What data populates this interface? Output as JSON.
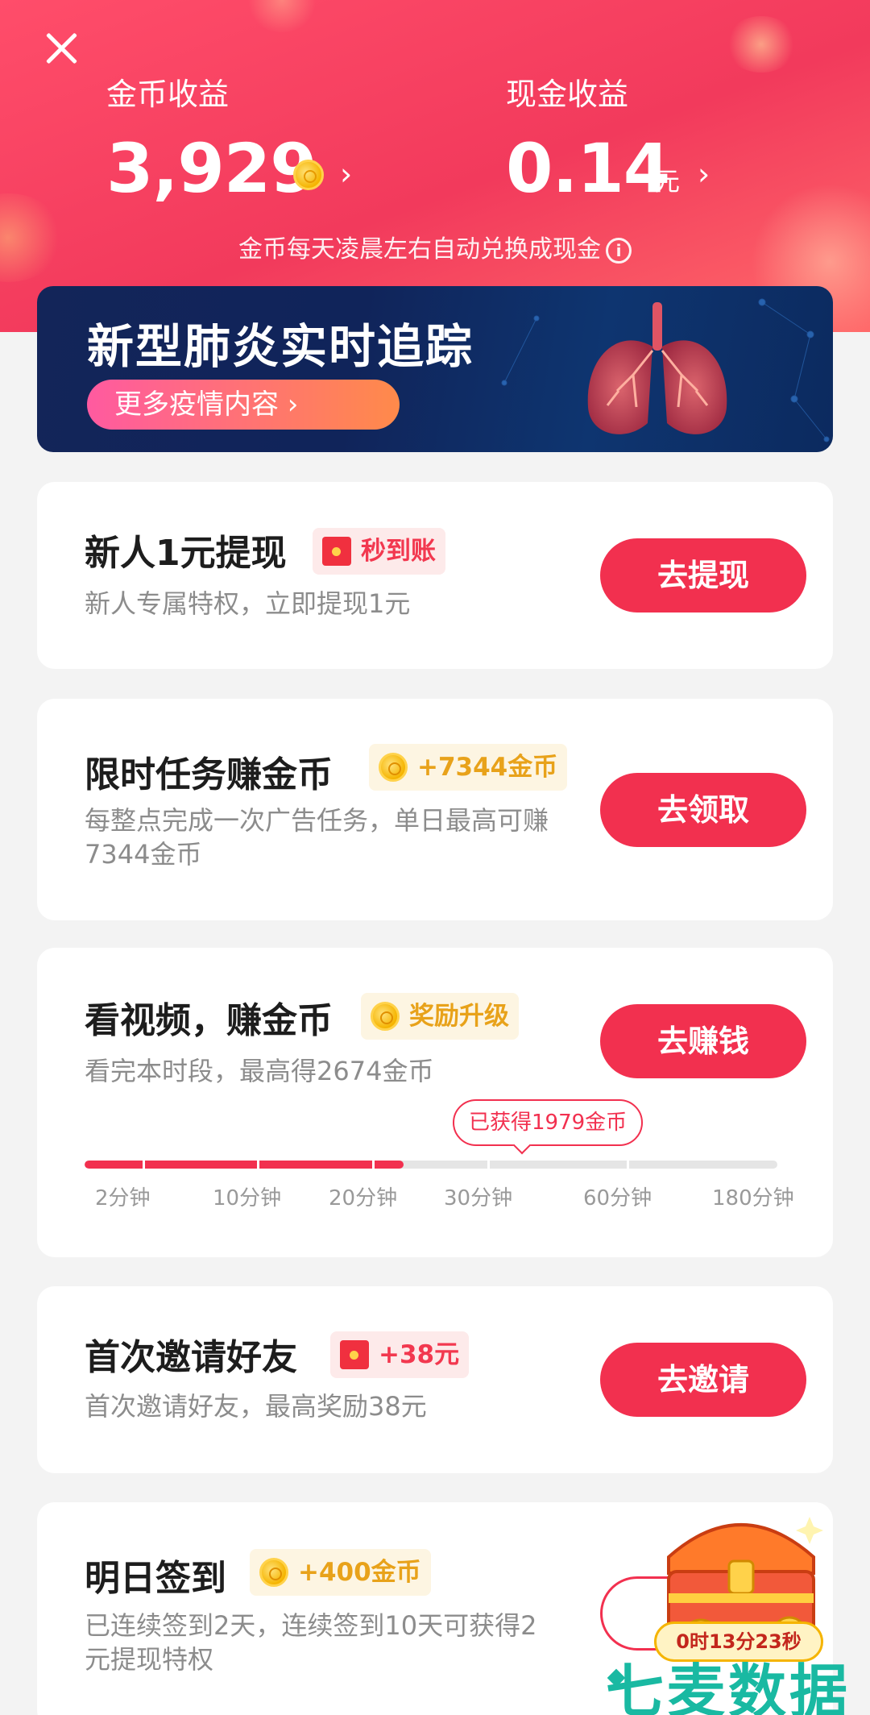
{
  "header": {
    "coin_label": "金币收益",
    "coin_value": "3,929",
    "cash_label": "现金收益",
    "cash_value": "0.14",
    "cash_unit": "元",
    "note": "金币每天凌晨左右自动兑换成现金",
    "info_icon_glyph": "i",
    "chevron": "›"
  },
  "banner": {
    "title": "新型肺炎实时追踪",
    "button": "更多疫情内容 ›"
  },
  "tasks": [
    {
      "title": "新人1元提现",
      "badge": "秒到账",
      "badge_icon": "red-envelope-icon",
      "desc": "新人专属特权，立即提现1元",
      "button": "去提现"
    },
    {
      "title": "限时任务赚金币",
      "badge": "+7344金币",
      "badge_icon": "coin-icon",
      "desc": "每整点完成一次广告任务，单日最高可赚7344金币",
      "button": "去领取"
    },
    {
      "title": "看视频，赚金币",
      "badge": "奖励升级",
      "badge_icon": "coin-icon",
      "desc": "看完本时段，最高得2674金币",
      "button": "去赚钱",
      "progress": {
        "earned_tip": "已获得1979金币",
        "ticks": [
          "2分钟",
          "10分钟",
          "20分钟",
          "30分钟",
          "60分钟",
          "180分钟"
        ],
        "progress_fraction": 0.46
      }
    },
    {
      "title": "首次邀请好友",
      "badge": "+38元",
      "badge_icon": "red-envelope-icon",
      "desc": "首次邀请好友，最高奖励38元",
      "button": "去邀请"
    },
    {
      "title": "明日签到",
      "badge": "+400金币",
      "badge_icon": "coin-icon",
      "desc": "已连续签到2天，连续签到10天可获得2元提现特权"
    }
  ],
  "chest": {
    "timer": "0时13分23秒"
  },
  "watermark": "七麦数据",
  "colors": {
    "accent": "#f2304f",
    "header_bg": "#f23a5c",
    "badge_gold": "#e8a21a",
    "watermark": "#19b9a2"
  }
}
